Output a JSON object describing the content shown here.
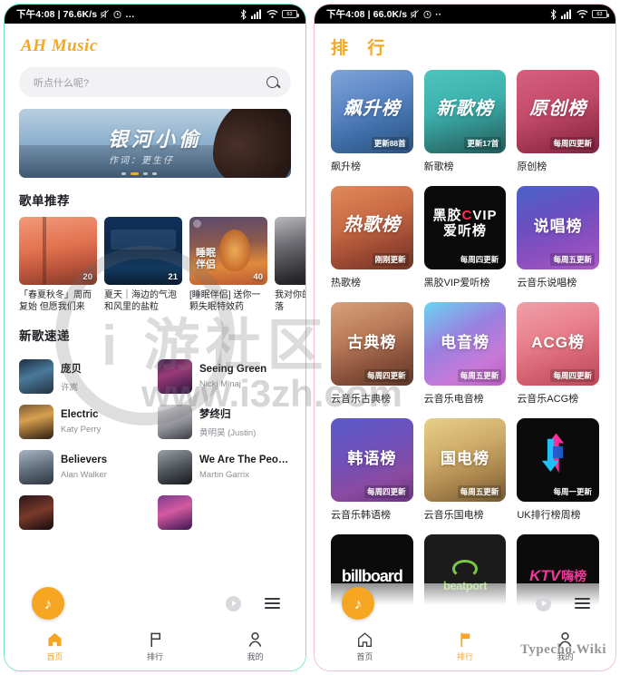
{
  "statusbar_left": {
    "time": "下午4:08",
    "net_left": "76.6K/s",
    "net_right": "66.0K/s",
    "dots": "…"
  },
  "left_phone": {
    "app_name": "AH Music",
    "search": {
      "placeholder": "听点什么呢?",
      "icon": "search-icon"
    },
    "banner": {
      "title": "银河小偷",
      "subtitle": "作词：更生仔"
    },
    "sections": [
      {
        "title": "歌单推荐"
      },
      {
        "title": "新歌速递"
      }
    ],
    "playlists": [
      {
        "name": "「春夏秋冬」周而复始 但愿我们来日…",
        "count": "20",
        "overlay": ""
      },
      {
        "name": "夏天｜海边的气泡和风里的盐粒",
        "count": "21",
        "overlay": ""
      },
      {
        "name": "[睡眠伴侣] 送你一颗失眠特效药",
        "count": "40",
        "overlay": "睡眠\n伴侣"
      },
      {
        "name": "我对你的爱涌 永不落",
        "count": "",
        "overlay": ""
      }
    ],
    "songs": [
      {
        "name": "庞贝",
        "artist": "许嵩"
      },
      {
        "name": "Seeing Green",
        "artist": "Nicki Minaj"
      },
      {
        "name": "Electric",
        "artist": "Katy Perry"
      },
      {
        "name": "梦终归",
        "artist": "黄明昊 (Justin)"
      },
      {
        "name": "Believers",
        "artist": "Alan Walker"
      },
      {
        "name": "We Are The Peopl…",
        "artist": "Martin Garrix"
      }
    ],
    "tabs": [
      {
        "label": "首页",
        "icon": "home-icon",
        "active": true
      },
      {
        "label": "排行",
        "icon": "flag-icon",
        "active": false
      },
      {
        "label": "我的",
        "icon": "user-icon",
        "active": false
      }
    ],
    "player": {
      "play_icon": "play-icon",
      "list_icon": "playlist-icon",
      "ball_icon": "note-icon"
    }
  },
  "right_phone": {
    "title": "排 行",
    "rankings": [
      {
        "cover_text": "飙升榜",
        "tag": "更新88首",
        "name": "飙升榜",
        "style": "g1"
      },
      {
        "cover_text": "新歌榜",
        "tag": "更新17首",
        "name": "新歌榜",
        "style": "g2"
      },
      {
        "cover_text": "原创榜",
        "tag": "每周四更新",
        "name": "原创榜",
        "style": "g3"
      },
      {
        "cover_text": "热歌榜",
        "tag": "刚刚更新",
        "name": "热歌榜",
        "style": "g4"
      },
      {
        "cover_text": "黑胶VIP 爱听榜",
        "tag": "每周四更新",
        "name": "黑胶VIP爱听榜",
        "style": "dark"
      },
      {
        "cover_text": "说唱榜",
        "tag": "每周五更新",
        "name": "云音乐说唱榜",
        "style": "g5"
      },
      {
        "cover_text": "古典榜",
        "tag": "每周四更新",
        "name": "云音乐古典榜",
        "style": "g6"
      },
      {
        "cover_text": "电音榜",
        "tag": "每周五更新",
        "name": "云音乐电音榜",
        "style": "g7"
      },
      {
        "cover_text": "ACG榜",
        "tag": "每周四更新",
        "name": "云音乐ACG榜",
        "style": "g8"
      },
      {
        "cover_text": "韩语榜",
        "tag": "每周四更新",
        "name": "云音乐韩语榜",
        "style": "g9"
      },
      {
        "cover_text": "国电榜",
        "tag": "每周五更新",
        "name": "云音乐国电榜",
        "style": "g10"
      },
      {
        "cover_text": "",
        "tag": "每周一更新",
        "name": "UK排行榜周榜",
        "style": "dark"
      },
      {
        "cover_text": "billboard",
        "tag": "",
        "name": "",
        "style": "dark"
      },
      {
        "cover_text": "beatport",
        "tag": "",
        "name": "",
        "style": "dark"
      },
      {
        "cover_text": "KTV嗨榜",
        "tag": "",
        "name": "",
        "style": "dark"
      }
    ],
    "tabs": [
      {
        "label": "首页",
        "icon": "home-icon",
        "active": false
      },
      {
        "label": "排行",
        "icon": "flag-icon",
        "active": true
      },
      {
        "label": "我的",
        "icon": "user-icon",
        "active": false
      }
    ]
  },
  "watermarks": {
    "site": "www.i3zh.com",
    "community": "i 游社区",
    "typecho": "Typecho.Wiki"
  },
  "colors": {
    "accent": "#f6a623",
    "left_border": "#7fe3d4",
    "right_border": "#f4c3c8"
  }
}
